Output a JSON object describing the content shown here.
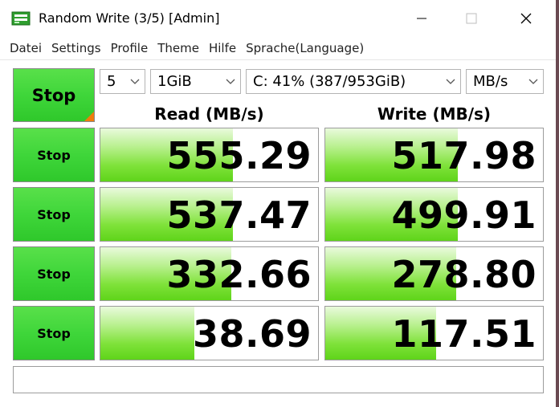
{
  "window": {
    "title": "Random Write (3/5) [Admin]",
    "minimize_glyph": "—",
    "maximize_glyph": "☐",
    "close_glyph": "✕"
  },
  "menu": [
    "Datei",
    "Settings",
    "Profile",
    "Theme",
    "Hilfe",
    "Sprache(Language)"
  ],
  "controls": {
    "main_stop_label": "Stop",
    "count": "5",
    "size": "1GiB",
    "drive": "C: 41% (387/953GiB)",
    "unit": "MB/s"
  },
  "headers": {
    "read": "Read (MB/s)",
    "write": "Write (MB/s)"
  },
  "rows": [
    {
      "stop_label": "Stop",
      "read": "555.29",
      "write": "517.98",
      "read_fill_pct": 61,
      "write_fill_pct": 61
    },
    {
      "stop_label": "Stop",
      "read": "537.47",
      "write": "499.91",
      "read_fill_pct": 61,
      "write_fill_pct": 61
    },
    {
      "stop_label": "Stop",
      "read": "332.66",
      "write": "278.80",
      "read_fill_pct": 60,
      "write_fill_pct": 60
    },
    {
      "stop_label": "Stop",
      "read": "38.69",
      "write": "117.51",
      "read_fill_pct": 43,
      "write_fill_pct": 51
    }
  ],
  "status_text": "",
  "colors": {
    "stop_green": "#3fd63a",
    "bar_green": "#5fd41a",
    "corner_orange": "#f07c0c"
  },
  "icons": {
    "app": "drive-icon",
    "dropdown": "chevron-down-icon"
  }
}
